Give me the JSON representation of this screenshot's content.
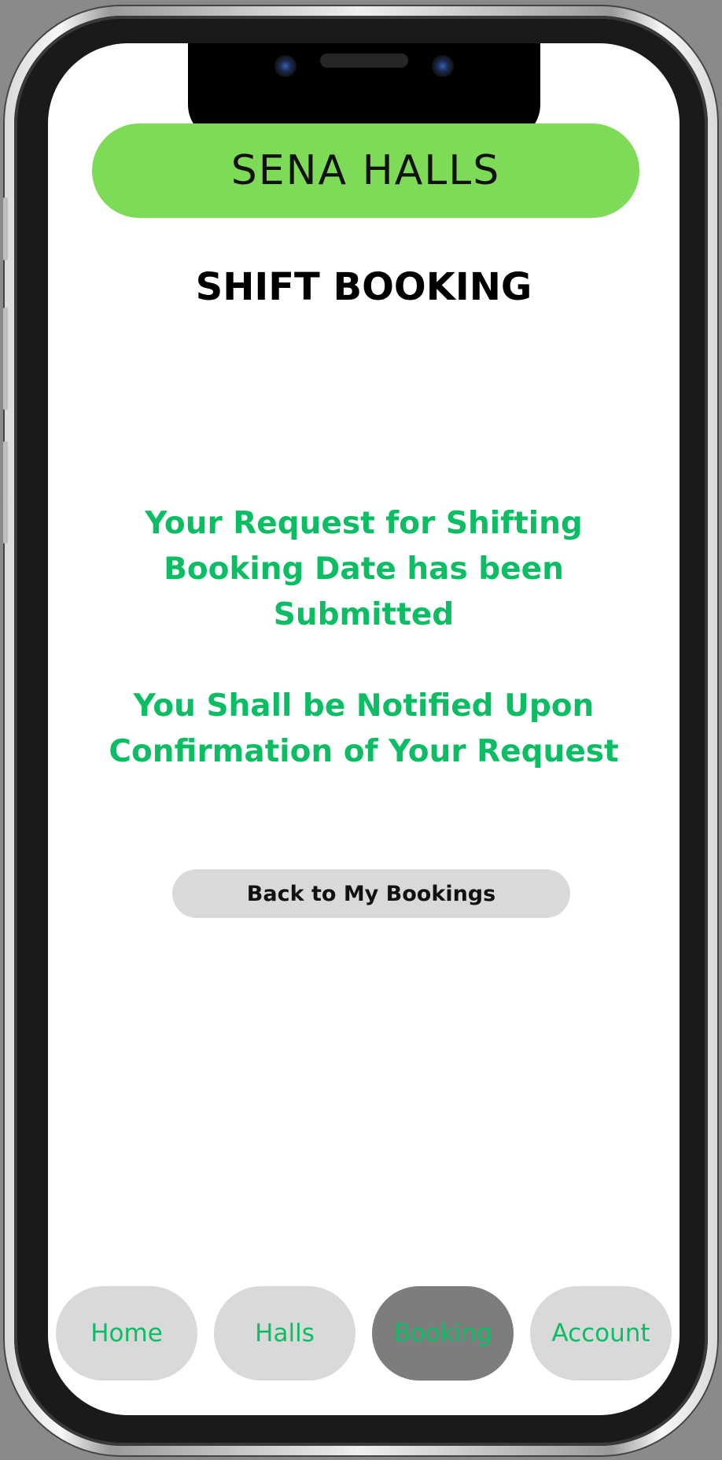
{
  "app": {
    "brand": "SENA HALLS"
  },
  "page": {
    "title": "SHIFT BOOKING"
  },
  "confirmation": {
    "submitted_message": "Your Request for Shifting Booking Date has been Submitted",
    "notify_message": "You Shall be Notified Upon Confirmation of Your Request"
  },
  "actions": {
    "back_label": "Back to My Bookings"
  },
  "nav": {
    "items": [
      {
        "label": "Home"
      },
      {
        "label": "Halls"
      },
      {
        "label": "Booking",
        "active": true
      },
      {
        "label": "Account"
      }
    ]
  },
  "colors": {
    "brand_green": "#7edb57",
    "text_green": "#0cbd63",
    "button_gray": "#d9d9d9",
    "active_nav_gray": "#7d7d7d"
  }
}
